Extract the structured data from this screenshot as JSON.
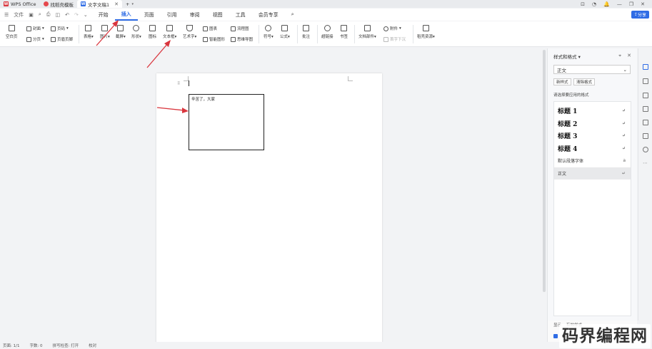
{
  "titlebar": {
    "tabs": [
      {
        "label": "WPS Office",
        "icon": "wps-logo-icon"
      },
      {
        "label": "找稻壳模板",
        "icon": "docer-icon"
      },
      {
        "label": "文字文稿1",
        "icon": "word-doc-icon",
        "active": true
      }
    ],
    "new_tab": "+",
    "window_controls": [
      "⊡",
      "◔",
      "🔔",
      "—",
      "❐",
      "✕"
    ]
  },
  "menubar": {
    "file_label": "文件",
    "items": [
      "开始",
      "插入",
      "页面",
      "引用",
      "审阅",
      "视图",
      "工具",
      "会员专享"
    ],
    "active_item": "插入",
    "share_label": "分享"
  },
  "ribbon": {
    "groups": [
      {
        "label": "空白页",
        "dropdown": true
      },
      {
        "label": "封面",
        "dropdown": true
      },
      {
        "label": "分页",
        "dropdown": true
      },
      {
        "label": "页码",
        "dropdown": true
      },
      {
        "label": "页眉页脚",
        "dropdown": false
      },
      {
        "label": "表格",
        "dropdown": true
      },
      {
        "label": "图片",
        "dropdown": true
      },
      {
        "label": "截屏",
        "dropdown": true
      },
      {
        "label": "形状",
        "dropdown": true
      },
      {
        "label": "图标",
        "dropdown": false
      },
      {
        "label": "文本框",
        "dropdown": true
      },
      {
        "label": "艺术字",
        "dropdown": true
      },
      {
        "label": "图表",
        "dropdown": false
      },
      {
        "label": "智能图形",
        "dropdown": false
      },
      {
        "label": "流程图",
        "dropdown": false
      },
      {
        "label": "思维导图",
        "dropdown": false
      },
      {
        "label": "符号",
        "dropdown": true
      },
      {
        "label": "公式",
        "dropdown": true
      },
      {
        "label": "批注",
        "dropdown": false
      },
      {
        "label": "超链接",
        "dropdown": false
      },
      {
        "label": "书签",
        "dropdown": false
      },
      {
        "label": "文档部件",
        "dropdown": true
      },
      {
        "label": "附件",
        "dropdown": true
      },
      {
        "label": "首字下沉",
        "dropdown": false
      },
      {
        "label": "稻壳资源",
        "dropdown": true
      }
    ]
  },
  "document": {
    "textbox_text": "辛苦了，大家"
  },
  "sidepanel": {
    "title": "样式和格式",
    "current_style": "正文",
    "new_style_btn": "新样式",
    "clear_format_btn": "清除格式",
    "hint": "请选择要应用的格式",
    "styles": [
      {
        "label": "标题 1",
        "kind": "heading",
        "mark": "↵"
      },
      {
        "label": "标题 2",
        "kind": "heading",
        "mark": "↵"
      },
      {
        "label": "标题 3",
        "kind": "heading",
        "mark": "↵"
      },
      {
        "label": "标题 4",
        "kind": "heading",
        "mark": "↵"
      },
      {
        "label": "默认段落字体",
        "kind": "plain",
        "mark": "a"
      },
      {
        "label": "正文",
        "kind": "plain",
        "mark": "↵",
        "selected": true
      }
    ],
    "bottom_tabs": [
      "显示",
      "有效样式"
    ]
  },
  "statusbar": {
    "items": [
      "页面: 1/1",
      "字数: 0",
      "拼写检查: 打开",
      "校对"
    ]
  },
  "watermark": "码界编程网",
  "colors": {
    "accent": "#2f6ce5",
    "arrow": "#d9363e"
  }
}
